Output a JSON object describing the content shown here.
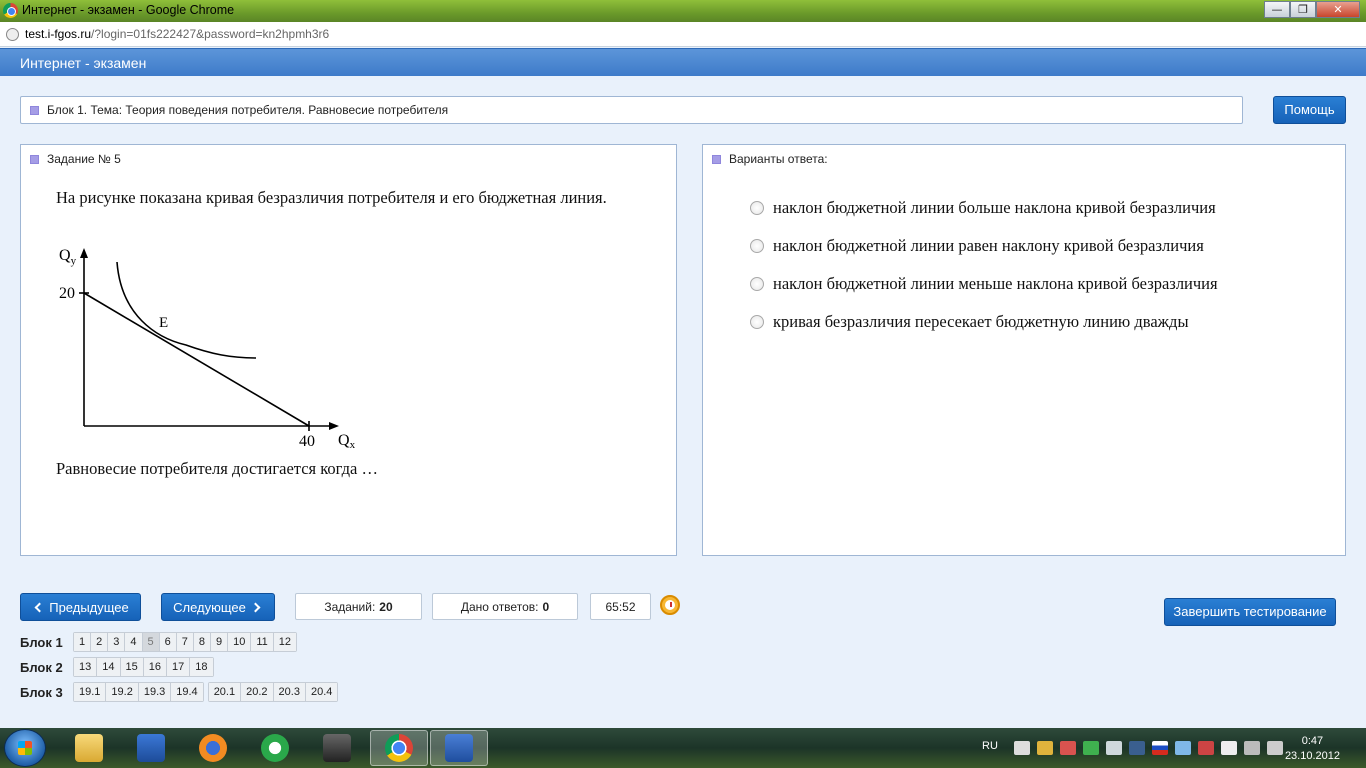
{
  "window": {
    "title": "Интернет - экзамен - Google Chrome",
    "minimize": "—",
    "maximize": "❐",
    "close": "✕"
  },
  "address": {
    "host": "test.i-fgos.ru",
    "path": "/?login=01fs222427&password=kn2hpmh3r6"
  },
  "app": {
    "header": "Интернет - экзамен"
  },
  "block": {
    "title": "Блок 1. Тема: Теория поведения потребителя. Равновесие потребителя",
    "help_label": "Помощь"
  },
  "task": {
    "header": "Задание № 5",
    "intro": "На рисунке показана кривая безразличия потребителя и его бюджетная линия.",
    "question": "Равновесие потребителя достигается когда …",
    "figure": {
      "y_label": "Q",
      "y_sub": "y",
      "x_label": "Q",
      "x_sub": "x",
      "y_intercept": "20",
      "x_intercept": "40",
      "point": "E"
    }
  },
  "answers": {
    "header": "Варианты ответа:",
    "options": [
      "наклон бюджетной линии больше наклона кривой безразличия",
      "наклон бюджетной линии равен наклону кривой безразличия",
      "наклон бюджетной линии меньше наклона кривой безразличия",
      "кривая безразличия пересекает бюджетную линию дважды"
    ]
  },
  "nav": {
    "prev_label": "Предыдущее",
    "next_label": "Следующее",
    "tasks_label": "Заданий:",
    "tasks_count": "20",
    "answered_label": "Дано ответов:",
    "answered_count": "0",
    "timer": "65:52",
    "finish_label": "Завершить тестирование",
    "current_task": "5"
  },
  "blocks": [
    {
      "label": "Блок 1",
      "groups": [
        [
          "1",
          "2",
          "3",
          "4",
          "5",
          "6",
          "7",
          "8",
          "9",
          "10",
          "11",
          "12"
        ]
      ]
    },
    {
      "label": "Блок 2",
      "groups": [
        [
          "13",
          "14",
          "15",
          "16",
          "17",
          "18"
        ]
      ]
    },
    {
      "label": "Блок 3",
      "groups": [
        [
          "19.1",
          "19.2",
          "19.3",
          "19.4"
        ],
        [
          "20.1",
          "20.2",
          "20.3",
          "20.4"
        ]
      ]
    }
  ],
  "taskbar": {
    "language": "RU",
    "time": "0:47",
    "date": "23.10.2012"
  }
}
